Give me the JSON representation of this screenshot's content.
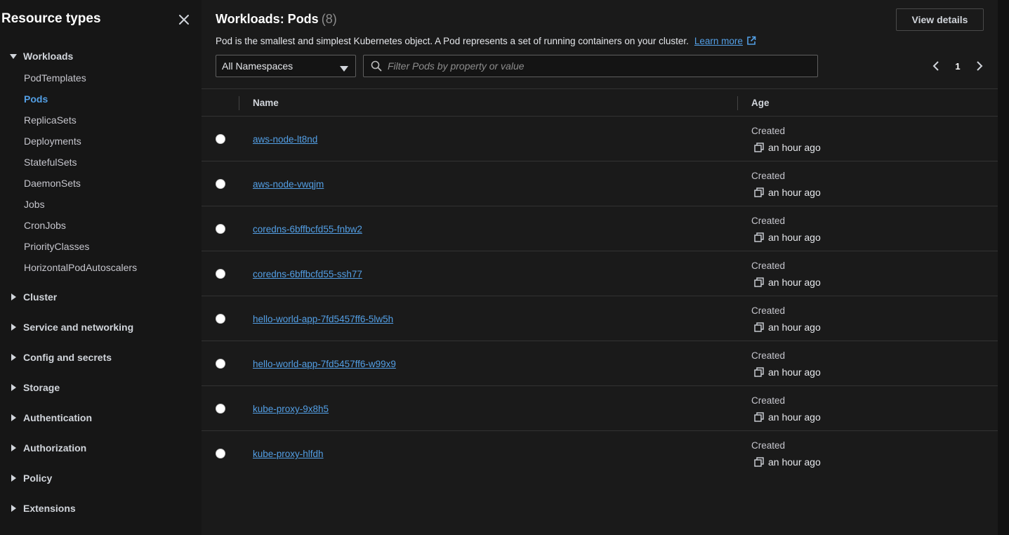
{
  "sidebar": {
    "title": "Resource types",
    "groups": [
      {
        "label": "Workloads",
        "expanded": true
      },
      {
        "label": "Cluster"
      },
      {
        "label": "Service and networking"
      },
      {
        "label": "Config and secrets"
      },
      {
        "label": "Storage"
      },
      {
        "label": "Authentication"
      },
      {
        "label": "Authorization"
      },
      {
        "label": "Policy"
      },
      {
        "label": "Extensions"
      }
    ],
    "workload_items": [
      {
        "label": "PodTemplates"
      },
      {
        "label": "Pods",
        "active": true
      },
      {
        "label": "ReplicaSets"
      },
      {
        "label": "Deployments"
      },
      {
        "label": "StatefulSets"
      },
      {
        "label": "DaemonSets"
      },
      {
        "label": "Jobs"
      },
      {
        "label": "CronJobs"
      },
      {
        "label": "PriorityClasses"
      },
      {
        "label": "HorizontalPodAutoscalers"
      }
    ]
  },
  "header": {
    "title": "Workloads: Pods",
    "count": "(8)",
    "view_details_label": "View details",
    "description": "Pod is the smallest and simplest Kubernetes object. A Pod represents a set of running containers on your cluster.",
    "learn_more": "Learn more"
  },
  "filters": {
    "namespace_value": "All Namespaces",
    "search_placeholder": "Filter Pods by property or value",
    "page": "1"
  },
  "table": {
    "columns": [
      "Name",
      "Age"
    ],
    "rows": [
      {
        "name": "aws-node-lt8nd",
        "age_label": "Created",
        "age": "an hour ago"
      },
      {
        "name": "aws-node-vwqjm",
        "age_label": "Created",
        "age": "an hour ago"
      },
      {
        "name": "coredns-6bffbcfd55-fnbw2",
        "age_label": "Created",
        "age": "an hour ago"
      },
      {
        "name": "coredns-6bffbcfd55-ssh77",
        "age_label": "Created",
        "age": "an hour ago"
      },
      {
        "name": "hello-world-app-7fd5457ff6-5lw5h",
        "age_label": "Created",
        "age": "an hour ago"
      },
      {
        "name": "hello-world-app-7fd5457ff6-w99x9",
        "age_label": "Created",
        "age": "an hour ago"
      },
      {
        "name": "kube-proxy-9x8h5",
        "age_label": "Created",
        "age": "an hour ago"
      },
      {
        "name": "kube-proxy-hlfdh",
        "age_label": "Created",
        "age": "an hour ago"
      }
    ]
  },
  "colors": {
    "accent_link": "#539fe5",
    "background": "#161616",
    "panel": "#1a1a1a"
  }
}
